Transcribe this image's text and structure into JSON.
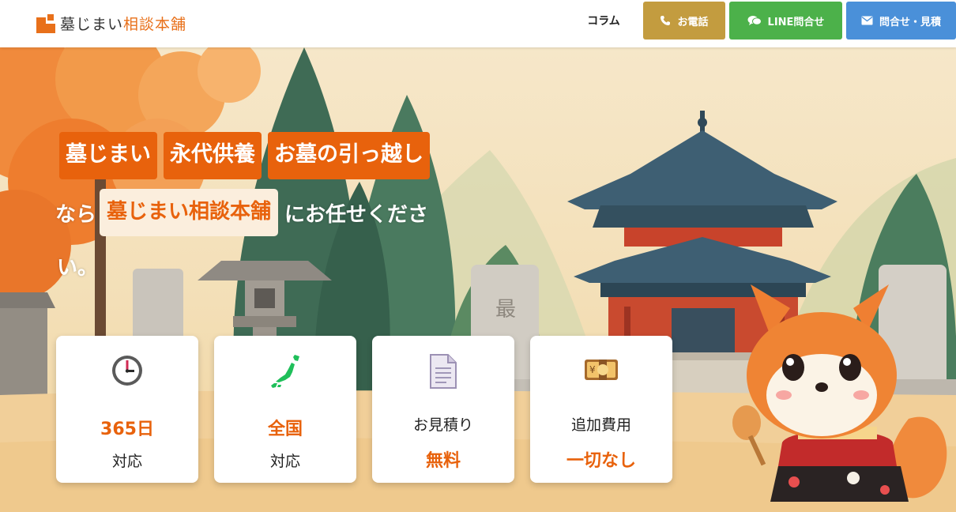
{
  "header": {
    "logo": {
      "main": "墓じまい",
      "accent": "相談本舗"
    },
    "nav": {
      "column": "コラム"
    },
    "buttons": {
      "phone": "お電話",
      "line": "LINE問合せ",
      "contact": "問合せ・見積"
    }
  },
  "hero": {
    "tags": [
      "墓じまい",
      "永代供養",
      "お墓の引っ越し"
    ],
    "line2_prefix": "なら",
    "line2_highlight": "墓じまい相談本舗",
    "line2_suffix": "にお任せくださ",
    "line3": "い。"
  },
  "features": [
    {
      "icon": "clock-icon",
      "top": "365日",
      "bottom": "対応",
      "emphasis": "top"
    },
    {
      "icon": "japan-map-icon",
      "top": "全国",
      "bottom": "対応",
      "emphasis": "top"
    },
    {
      "icon": "document-icon",
      "top": "お見積り",
      "bottom": "無料",
      "emphasis": "bottom"
    },
    {
      "icon": "money-icon",
      "top": "追加費用",
      "bottom": "一切なし",
      "emphasis": "bottom"
    }
  ],
  "colors": {
    "accent": "#e8620c",
    "phone": "#c39c3f",
    "line": "#4cb14a",
    "contact": "#4a90d9"
  }
}
